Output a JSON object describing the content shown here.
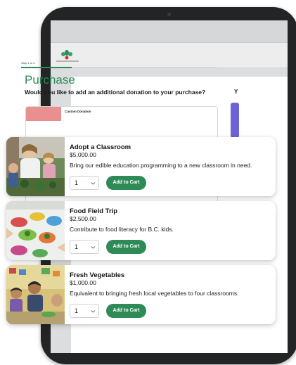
{
  "step_label": "Step 1 of 4",
  "page_title": "Purchase",
  "question": "Would you like to add an additional donation to your purchase?",
  "background_card_title": "Custom Donation",
  "colors": {
    "accent": "#2e8b57",
    "tablet": "#232425",
    "side_card": "#6c63d9",
    "custom_thumb": "#e98f8f"
  },
  "cards": [
    {
      "title": "Adopt a Classroom",
      "price": "$5,000.00",
      "description": "Bring our edible education programming to a new classroom in need.",
      "quantity": "1",
      "button": "Add to Cart",
      "image": "children-planting-photo"
    },
    {
      "title": "Food Field Trip",
      "price": "$2,500.00",
      "description": "Contribute to food literacy for B.C. kids.",
      "quantity": "1",
      "button": "Add to Cart",
      "image": "salad-bowls-photo"
    },
    {
      "title": "Fresh Vegetables",
      "price": "$1,000.00",
      "description": "Equivalent to bringing fresh local vegetables to four classrooms.",
      "quantity": "1",
      "button": "Add to Cart",
      "image": "classroom-kids-photo"
    }
  ]
}
